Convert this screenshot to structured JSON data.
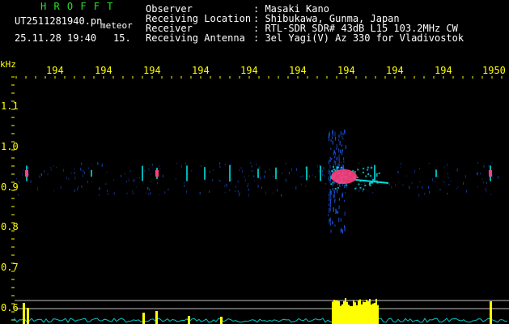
{
  "header": {
    "brand": "H R O F F T",
    "filename": "UT2511281940.pn",
    "meteor_label": "meteor",
    "datetime": "25.11.28 19:40",
    "count": "15.",
    "info_labels": [
      "Observer",
      "Receiving Location",
      "Receiver",
      "Receiving Antenna"
    ],
    "info_values": [
      ": Masaki Kano",
      ": Shibukawa, Gunma, Japan",
      ": RTL-SDR SDR# 43dB L15 103.2MHz CW",
      ": 3el Yagi(V) Az 330 for Vladivostok"
    ]
  },
  "axis": {
    "unit": "kHz",
    "time_ticks": [
      "194",
      "194",
      "194",
      "194",
      "194",
      "194",
      "194",
      "194",
      "194",
      "1950"
    ],
    "freq_ticks": [
      "1.1",
      "1.0",
      "0.9",
      "0.8",
      "0.7",
      "0.6"
    ]
  },
  "colors": {
    "background": "#000000",
    "text": "#ffffff",
    "brand": "#28e028",
    "ticks": "#ffff00",
    "signal_blue": "#2060ff",
    "signal_cyan": "#00e0e0",
    "signal_pink": "#ff4080",
    "histogram": "#ffff00",
    "noise_floor": "#00c8c8"
  }
}
